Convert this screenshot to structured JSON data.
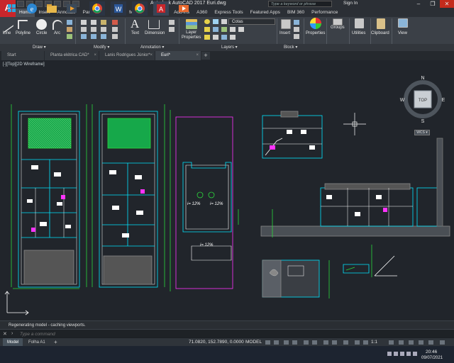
{
  "app": {
    "title": "Autodesk AutoCAD 2017    Euri.dwg",
    "logo_letter": "A",
    "search_placeholder": "Type a keyword or phrase",
    "signin": "Sign In"
  },
  "ribbon_tabs": [
    "Home",
    "Insert",
    "Annotate",
    "Parametric",
    "View",
    "Manage",
    "Output",
    "Add-ins",
    "A360",
    "Express Tools",
    "Featured Apps",
    "BIM 360",
    "Performance"
  ],
  "ribbon": {
    "draw": [
      "Line",
      "Polyline",
      "Circle",
      "Arc"
    ],
    "text": "Text",
    "dimension": "Dimension",
    "layer_properties": "Layer\nProperties",
    "layer_combo": "Cotas",
    "insert": "Insert",
    "properties": "Properties",
    "groups": "Groups",
    "utilities": "Utilities",
    "clipboard": "Clipboard",
    "view": "View",
    "panels": [
      "Draw ▾",
      "Modify ▾",
      "Annotation ▾",
      "Layers ▾",
      "Block ▾"
    ]
  },
  "doc_tabs": [
    {
      "label": "Start",
      "active": false
    },
    {
      "label": "Planta elétrica CAD*",
      "active": false
    },
    {
      "label": "Lanis Rodrigues Júnior*",
      "active": false
    },
    {
      "label": "Euri*",
      "active": true
    }
  ],
  "viewport_label": "[-][Top][2D Wireframe]",
  "viewcube": {
    "top": "TOP",
    "n": "N",
    "s": "S",
    "e": "E",
    "w": "W",
    "wcs": "WCS ▾"
  },
  "drawing_text": {
    "slope1": "i= 12%",
    "slope2": "i= 12%",
    "slope3": "i= 12%"
  },
  "command": {
    "history": "Regenerating model - caching viewports.",
    "placeholder": "Type a command"
  },
  "status": {
    "layout_tabs": [
      "Model",
      "Folha A1"
    ],
    "coords": "71.0820, 152.7890, 0.0000",
    "model": "MODEL",
    "scale": "1:1"
  },
  "clock": {
    "time": "20:46",
    "date": "09/07/2021"
  },
  "colors": {
    "accent": "#c8262b",
    "drawing_bg": "#21252b",
    "cyan": "#00e5ff",
    "green": "#2bd93c",
    "magenta": "#ff33ff"
  }
}
